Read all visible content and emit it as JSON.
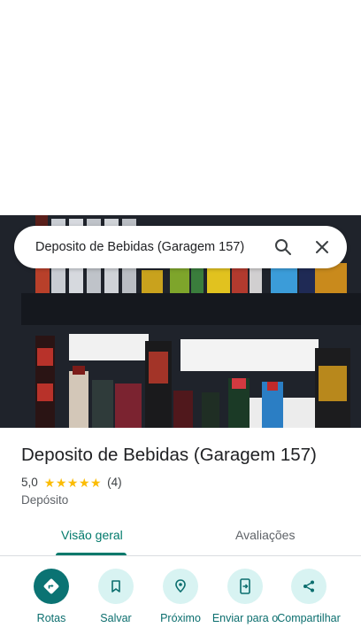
{
  "search": {
    "query": "Deposito de Bebidas (Garagem 157)"
  },
  "place": {
    "name": "Deposito de Bebidas (Garagem 157)",
    "rating": "5,0",
    "star_count": 5,
    "review_count": "(4)",
    "category": "Depósito"
  },
  "tabs": [
    {
      "label": "Visão geral",
      "active": true
    },
    {
      "label": "Avaliações",
      "active": false
    }
  ],
  "actions": [
    {
      "label": "Rotas",
      "icon": "directions-icon"
    },
    {
      "label": "Salvar",
      "icon": "bookmark-icon"
    },
    {
      "label": "Próximo",
      "icon": "nearby-icon"
    },
    {
      "label": "Enviar para o",
      "icon": "send-to-phone-icon"
    },
    {
      "label": "Compartilhar",
      "icon": "share-icon"
    }
  ],
  "colors": {
    "accent": "#00796b",
    "action_bg": "#d8f3f2",
    "action_primary": "#0b7373",
    "star": "#fbbc04"
  }
}
